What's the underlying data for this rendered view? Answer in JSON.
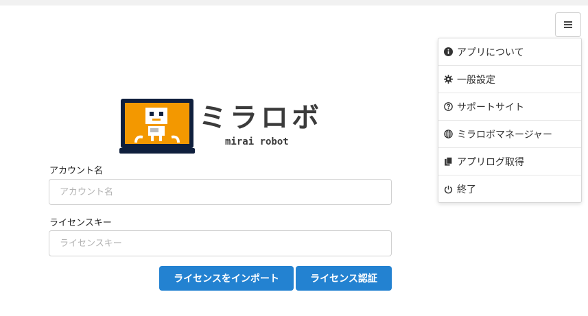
{
  "menu": {
    "items": [
      {
        "icon": "info-icon",
        "label": "アプリについて"
      },
      {
        "icon": "gear-icon",
        "label": "一般設定"
      },
      {
        "icon": "question-icon",
        "label": "サポートサイト"
      },
      {
        "icon": "globe-icon",
        "label": "ミラロボマネージャー"
      },
      {
        "icon": "copy-icon",
        "label": "アプリログ取得"
      },
      {
        "icon": "power-icon",
        "label": "終了"
      }
    ]
  },
  "logo": {
    "title": "ミラロボ",
    "subtitle": "mirai robot",
    "colors": {
      "screen": "#f39800",
      "frame": "#0f1f3d"
    }
  },
  "form": {
    "account_label": "アカウント名",
    "account_placeholder": "アカウント名",
    "account_value": "",
    "license_label": "ライセンスキー",
    "license_placeholder": "ライセンスキー",
    "license_value": ""
  },
  "buttons": {
    "import_label": "ライセンスをインポート",
    "auth_label": "ライセンス認証",
    "color": "#2382d1"
  }
}
